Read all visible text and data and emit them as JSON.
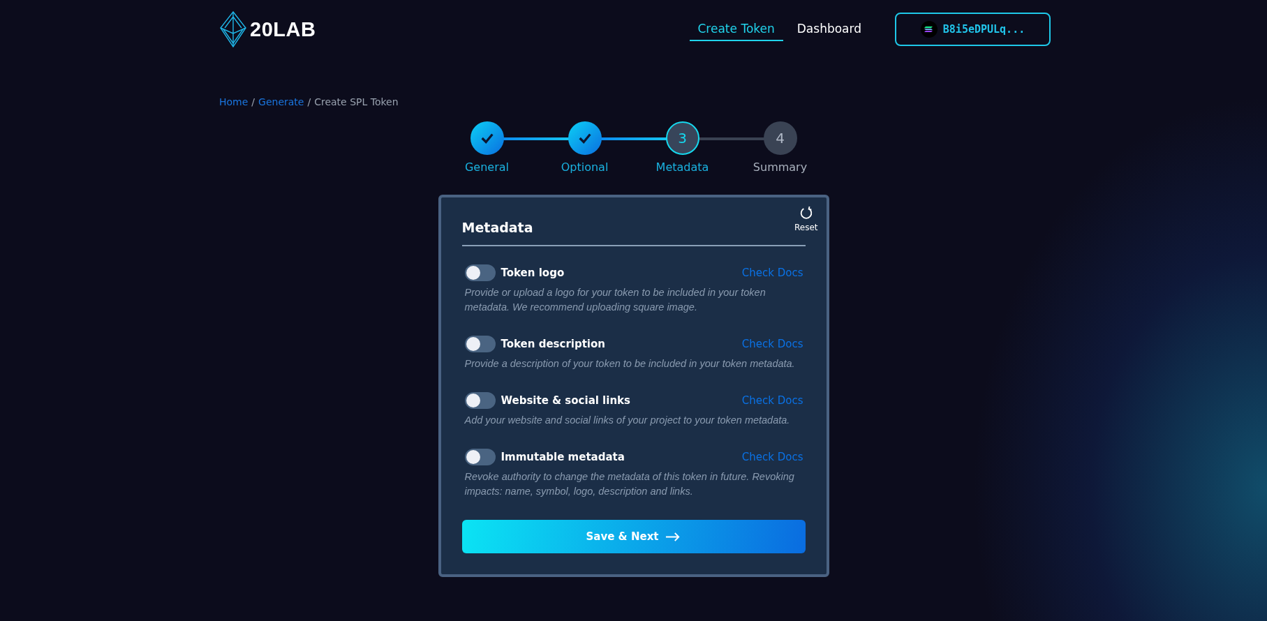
{
  "logo": {
    "text": "20LAB"
  },
  "nav": [
    {
      "label": "Create Token",
      "selected": true
    },
    {
      "label": "Dashboard",
      "selected": false
    }
  ],
  "wallet": {
    "address": "B8i5eDPULq..."
  },
  "breadcrumb": [
    {
      "label": "Home",
      "link": true
    },
    {
      "separator": "/"
    },
    {
      "label": "Generate",
      "link": true
    },
    {
      "separator": "/"
    },
    {
      "label": "Create SPL Token",
      "link": false
    }
  ],
  "steps": [
    {
      "label": "General",
      "completed": true,
      "selected": false
    },
    {
      "label": "Optional",
      "completed": true,
      "selected": false
    },
    {
      "label": "Metadata",
      "completed": false,
      "selected": true,
      "number": "3"
    },
    {
      "label": "Summary",
      "completed": false,
      "selected": false,
      "number": "4"
    }
  ],
  "card": {
    "title": "Metadata",
    "reset": "Reset",
    "options": [
      {
        "label": "Token logo",
        "on": false,
        "link": "Check Docs",
        "description": "Provide or upload a logo for your token to be included in your token metadata. We recommend uploading square image."
      },
      {
        "label": "Token description",
        "on": false,
        "link": "Check Docs",
        "description": "Provide a description of your token to be included in your token metadata."
      },
      {
        "label": "Website & social links",
        "on": false,
        "link": "Check Docs",
        "description": "Add your website and social links of your project to your token metadata."
      },
      {
        "label": "Immutable metadata",
        "on": false,
        "link": "Check Docs",
        "description": "Revoke authority to change the metadata of this token in future. Revoking impacts: name, symbol, logo, description and links."
      }
    ],
    "button": "Save & Next"
  }
}
